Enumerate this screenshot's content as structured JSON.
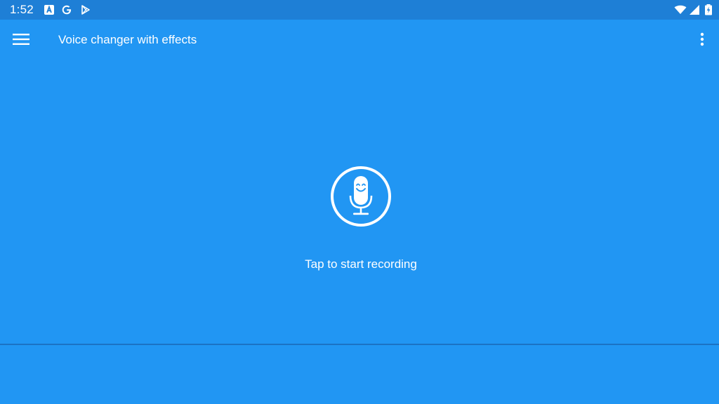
{
  "status_bar": {
    "time": "1:52",
    "notification_icons": [
      "text-a-notification-icon",
      "google-icon",
      "play-store-icon"
    ],
    "system_icons": [
      "wifi-icon",
      "cell-signal-icon",
      "battery-charging-icon"
    ]
  },
  "app_bar": {
    "title": "Voice changer with effects",
    "menu_icon": "hamburger-menu-icon",
    "overflow_icon": "more-vert-icon"
  },
  "main": {
    "record_icon": "smiling-microphone-icon",
    "hint": "Tap to start recording"
  },
  "colors": {
    "background": "#2196f3",
    "status_bar": "#1e7fd6",
    "divider": "#1b73c4",
    "foreground": "#ffffff"
  }
}
